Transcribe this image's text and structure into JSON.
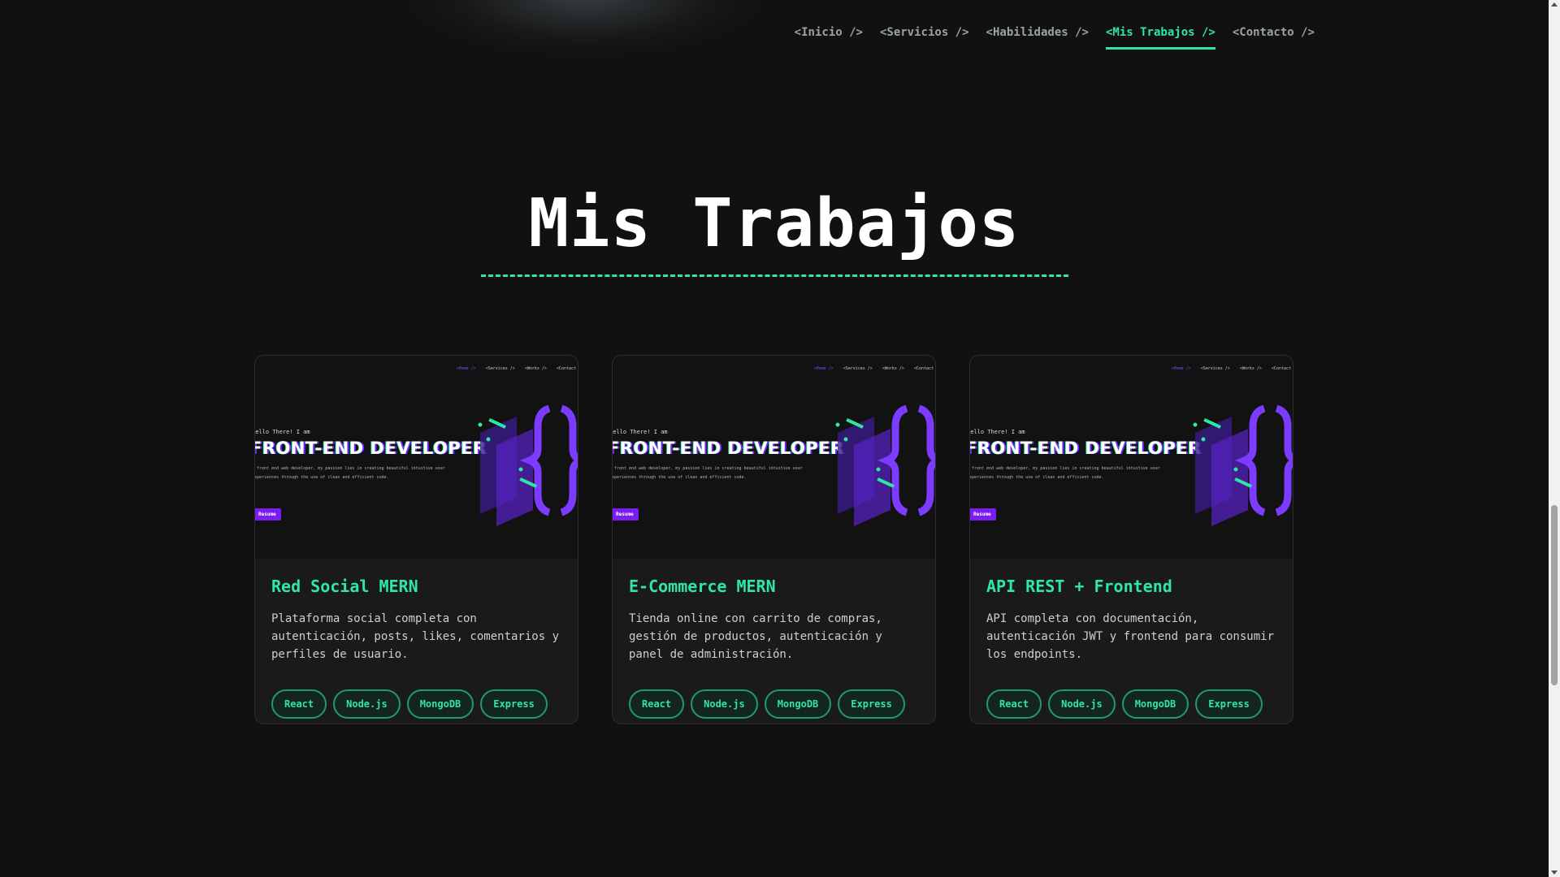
{
  "nav": {
    "items": [
      {
        "label": "<Inicio />"
      },
      {
        "label": "<Servicios />"
      },
      {
        "label": "<Habilidades />"
      },
      {
        "label": "<Mis Trabajos />",
        "active": true
      },
      {
        "label": "<Contacto />"
      }
    ]
  },
  "section": {
    "title": "Mis Trabajos"
  },
  "thumbnail": {
    "nav": [
      "<Home />",
      "<Services />",
      "<Works />",
      "<Contact"
    ],
    "hello": "Hello There! I am",
    "role": "FRONT-END DEVELOPER",
    "desc": "a front end web developer, my passion lies in creating beautiful intuitive user experiences through the use of clean and efficient code.",
    "button": "Resume"
  },
  "projects": [
    {
      "title": "Red Social MERN",
      "description": "Plataforma social completa con autenticación, posts, likes, comentarios y perfiles de usuario.",
      "tags": [
        "React",
        "Node.js",
        "MongoDB",
        "Express"
      ]
    },
    {
      "title": "E-Commerce MERN",
      "description": "Tienda online con carrito de compras, gestión de productos, autenticación y panel de administración.",
      "tags": [
        "React",
        "Node.js",
        "MongoDB",
        "Express"
      ]
    },
    {
      "title": "API REST + Frontend",
      "description": "API completa con documentación, autenticación JWT y frontend para consumir los endpoints.",
      "tags": [
        "React",
        "Node.js",
        "MongoDB",
        "Express"
      ]
    }
  ],
  "colors": {
    "accent": "#2fe6a7",
    "background": "#111111",
    "card": "#1a1a1a",
    "purple": "#7a1df0"
  }
}
